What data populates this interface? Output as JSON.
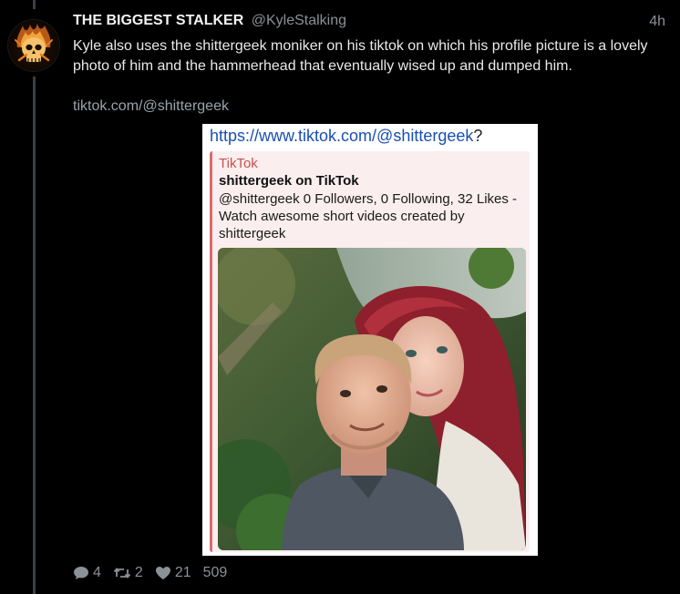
{
  "tweet": {
    "display_name": "THE BIGGEST STALKER",
    "handle": "@KyleStalking",
    "timestamp": "4h",
    "text": "Kyle also uses the shittergeek moniker on his tiktok on which his profile picture is a lovely photo of him and the hammerhead that eventually wised up and dumped him.",
    "link": "tiktok.com/@shittergeek",
    "avatar_icon": "flaming-skull-icon"
  },
  "embed": {
    "url": "https://www.tiktok.com/@shittergeek",
    "url_suffix": "?",
    "preview": {
      "site_name": "TikTok",
      "title": "shittergeek on TikTok",
      "description": "@shittergeek 0 Followers, 0 Following, 32 Likes - Watch awesome short videos created by shittergeek",
      "image_icon": "selfie-photo"
    }
  },
  "actions": {
    "reply_count": "4",
    "retweet_count": "2",
    "like_count": "21",
    "views_count": "509"
  },
  "colors": {
    "background": "#000000",
    "muted_text": "#8a9197",
    "link_blue": "#1a4fb3",
    "preview_accent": "#d96b6b",
    "preview_site": "#c9514f"
  }
}
